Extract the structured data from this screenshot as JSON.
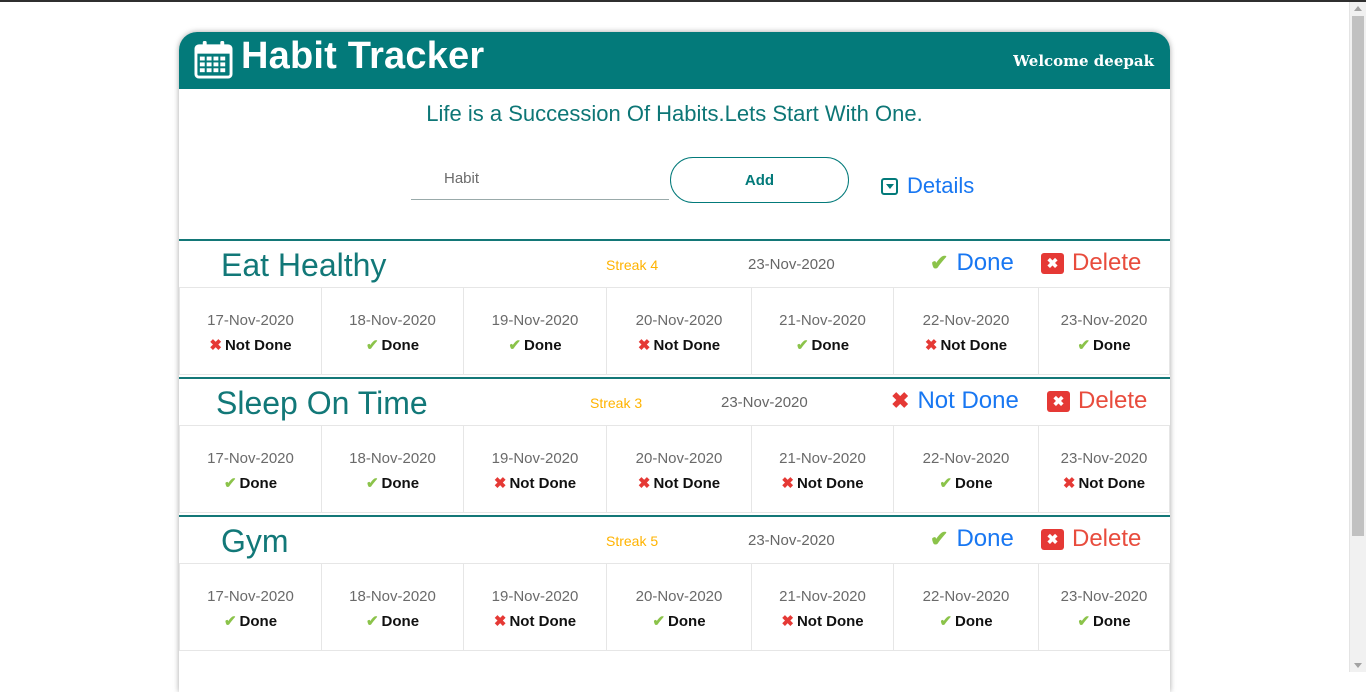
{
  "header": {
    "title": "Habit Tracker",
    "welcome": "Welcome deepak"
  },
  "tagline": "Life is a Succession Of Habits.Lets Start With One.",
  "form": {
    "placeholder": "Habit",
    "add_label": "Add",
    "details_label": "Details"
  },
  "habits": [
    {
      "name": "Eat Healthy",
      "streak": "Streak 4",
      "date": "23-Nov-2020",
      "status_label": "Done",
      "status_done": true,
      "delete_label": "Delete",
      "days": [
        {
          "date": "17-Nov-2020",
          "status": "Not Done",
          "done": false
        },
        {
          "date": "18-Nov-2020",
          "status": "Done",
          "done": true
        },
        {
          "date": "19-Nov-2020",
          "status": "Done",
          "done": true
        },
        {
          "date": "20-Nov-2020",
          "status": "Not Done",
          "done": false
        },
        {
          "date": "21-Nov-2020",
          "status": "Done",
          "done": true
        },
        {
          "date": "22-Nov-2020",
          "status": "Not Done",
          "done": false
        },
        {
          "date": "23-Nov-2020",
          "status": "Done",
          "done": true
        }
      ]
    },
    {
      "name": "Sleep On Time",
      "streak": "Streak 3",
      "date": "23-Nov-2020",
      "status_label": "Not Done",
      "status_done": false,
      "delete_label": "Delete",
      "days": [
        {
          "date": "17-Nov-2020",
          "status": "Done",
          "done": true
        },
        {
          "date": "18-Nov-2020",
          "status": "Done",
          "done": true
        },
        {
          "date": "19-Nov-2020",
          "status": "Not Done",
          "done": false
        },
        {
          "date": "20-Nov-2020",
          "status": "Not Done",
          "done": false
        },
        {
          "date": "21-Nov-2020",
          "status": "Not Done",
          "done": false
        },
        {
          "date": "22-Nov-2020",
          "status": "Done",
          "done": true
        },
        {
          "date": "23-Nov-2020",
          "status": "Not Done",
          "done": false
        }
      ]
    },
    {
      "name": "Gym",
      "streak": "Streak 5",
      "date": "23-Nov-2020",
      "status_label": "Done",
      "status_done": true,
      "delete_label": "Delete",
      "days": [
        {
          "date": "17-Nov-2020",
          "status": "Done",
          "done": true
        },
        {
          "date": "18-Nov-2020",
          "status": "Done",
          "done": true
        },
        {
          "date": "19-Nov-2020",
          "status": "Not Done",
          "done": false
        },
        {
          "date": "20-Nov-2020",
          "status": "Done",
          "done": true
        },
        {
          "date": "21-Nov-2020",
          "status": "Not Done",
          "done": false
        },
        {
          "date": "22-Nov-2020",
          "status": "Done",
          "done": true
        },
        {
          "date": "23-Nov-2020",
          "status": "Done",
          "done": true
        }
      ]
    }
  ],
  "icons": {
    "calendar": "calendar-icon",
    "check": "check-icon",
    "cross": "x-icon",
    "delete": "x-square-icon",
    "caret": "caret-square-down-icon"
  },
  "colors": {
    "header_bg": "#037a7a",
    "accent_teal": "#127878",
    "link_blue": "#1877f2",
    "streak_orange": "#ffb300",
    "done_green": "#8bc34a",
    "not_done_red": "#e53935",
    "delete_red": "#e84c3d"
  }
}
